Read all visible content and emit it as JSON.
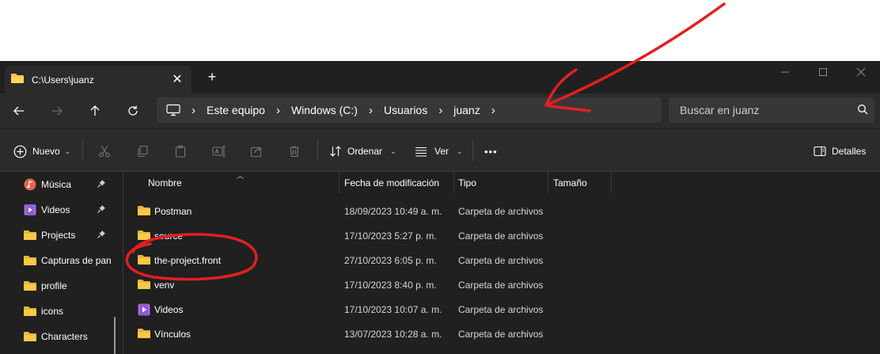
{
  "tab": {
    "title": "C:\\Users\\juanz",
    "close_glyph": "✕",
    "new_glyph": "+"
  },
  "window_controls": {
    "minimize": "—",
    "maximize": "☐",
    "close": "✕"
  },
  "breadcrumb": {
    "items": [
      "Este equipo",
      "Windows (C:)",
      "Usuarios",
      "juanz"
    ],
    "separator": "›"
  },
  "search": {
    "placeholder": "Buscar en juanz"
  },
  "commands": {
    "new_label": "Nuevo",
    "sort_label": "Ordenar",
    "view_label": "Ver",
    "more_label": "•••",
    "details_label": "Detalles"
  },
  "sidebar": {
    "items": [
      {
        "label": "Música",
        "icon": "music-icon",
        "pinned": true
      },
      {
        "label": "Videos",
        "icon": "video-icon",
        "pinned": true
      },
      {
        "label": "Projects",
        "icon": "folder-icon",
        "pinned": true
      },
      {
        "label": "Capturas de pan",
        "icon": "folder-icon",
        "pinned": false
      },
      {
        "label": "profile",
        "icon": "folder-icon",
        "pinned": false
      },
      {
        "label": "icons",
        "icon": "folder-icon",
        "pinned": false
      },
      {
        "label": "Characters",
        "icon": "folder-icon",
        "pinned": false
      }
    ]
  },
  "columns": {
    "name": "Nombre",
    "modified": "Fecha de modificación",
    "type": "Tipo",
    "size": "Tamaño"
  },
  "files": [
    {
      "name": "Postman",
      "modified": "18/09/2023 10:49 a. m.",
      "type": "Carpeta de archivos",
      "icon": "folder-icon"
    },
    {
      "name": "source",
      "modified": "17/10/2023 5:27 p. m.",
      "type": "Carpeta de archivos",
      "icon": "folder-icon"
    },
    {
      "name": "the-project.front",
      "modified": "27/10/2023 6:05 p. m.",
      "type": "Carpeta de archivos",
      "icon": "folder-icon"
    },
    {
      "name": "venv",
      "modified": "17/10/2023 8:40 p. m.",
      "type": "Carpeta de archivos",
      "icon": "folder-icon"
    },
    {
      "name": "Videos",
      "modified": "17/10/2023 10:07 a. m.",
      "type": "Carpeta de archivos",
      "icon": "video-folder-icon"
    },
    {
      "name": "Vínculos",
      "modified": "13/07/2023 10:28 a. m.",
      "type": "Carpeta de archivos",
      "icon": "folder-icon"
    }
  ],
  "colors": {
    "window_bg": "#202020",
    "toolbar_bg": "#2b2b2b",
    "folder_yellow": "#f7c948",
    "annotation_red": "#e02020"
  }
}
